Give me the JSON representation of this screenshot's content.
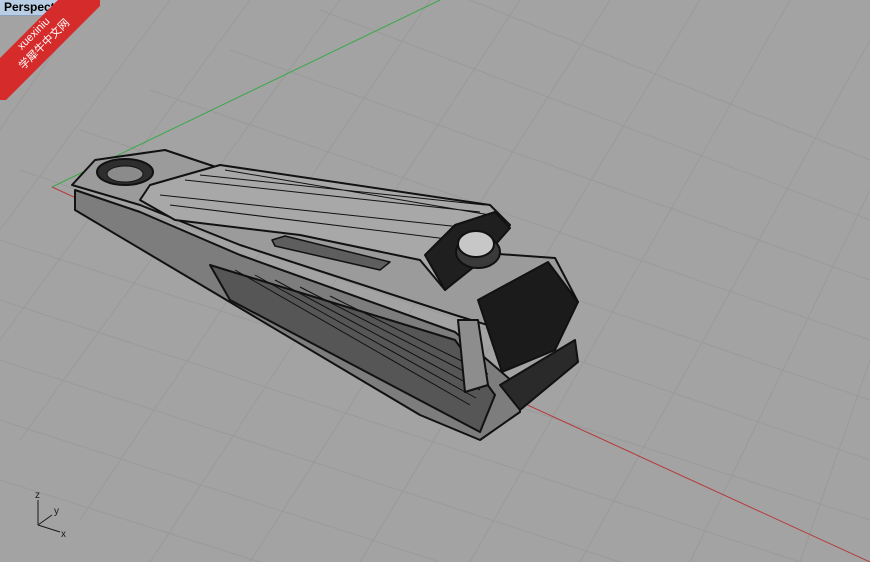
{
  "viewport": {
    "title": "Perspective",
    "axes": {
      "x": "x",
      "y": "y",
      "z": "z"
    }
  },
  "watermark": {
    "line1": "xuexiniu",
    "line2": "学犀牛中文网"
  },
  "colors": {
    "background": "#a3a3a3",
    "grid_minor": "#9a9a9a",
    "grid_major": "#8e8e8e",
    "x_axis": "#b53a3a",
    "y_axis": "#3aa84a",
    "title_bg": "#b9cde4",
    "watermark": "#d62b2b"
  },
  "model": {
    "name": "nail clipper",
    "display": "wireframe shaded"
  }
}
